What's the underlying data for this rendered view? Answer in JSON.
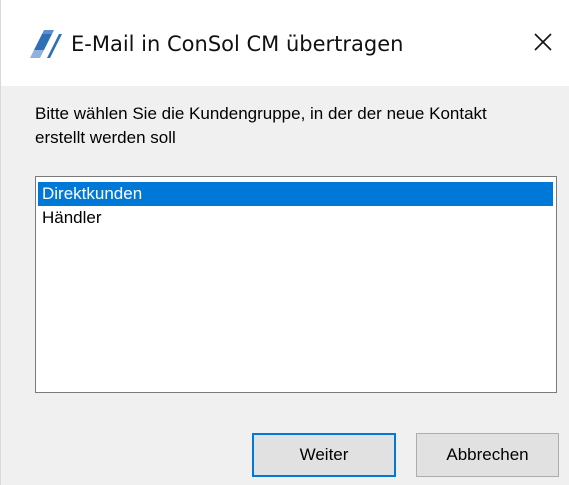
{
  "window": {
    "title": "E-Mail in ConSol CM übertragen",
    "app_icon": "consol-logo-icon",
    "close_icon": "close-icon"
  },
  "dialog": {
    "prompt": "Bitte wählen Sie die Kundengruppe, in der der neue Kontakt erstellt werden soll",
    "list": {
      "items": [
        {
          "label": "Direktkunden",
          "selected": true
        },
        {
          "label": "Händler",
          "selected": false
        }
      ]
    },
    "buttons": {
      "next_label": "Weiter",
      "cancel_label": "Abbrechen"
    }
  },
  "colors": {
    "selection": "#0078d7",
    "default_button_border": "#0078d7",
    "logo": "#2f6fb5"
  }
}
